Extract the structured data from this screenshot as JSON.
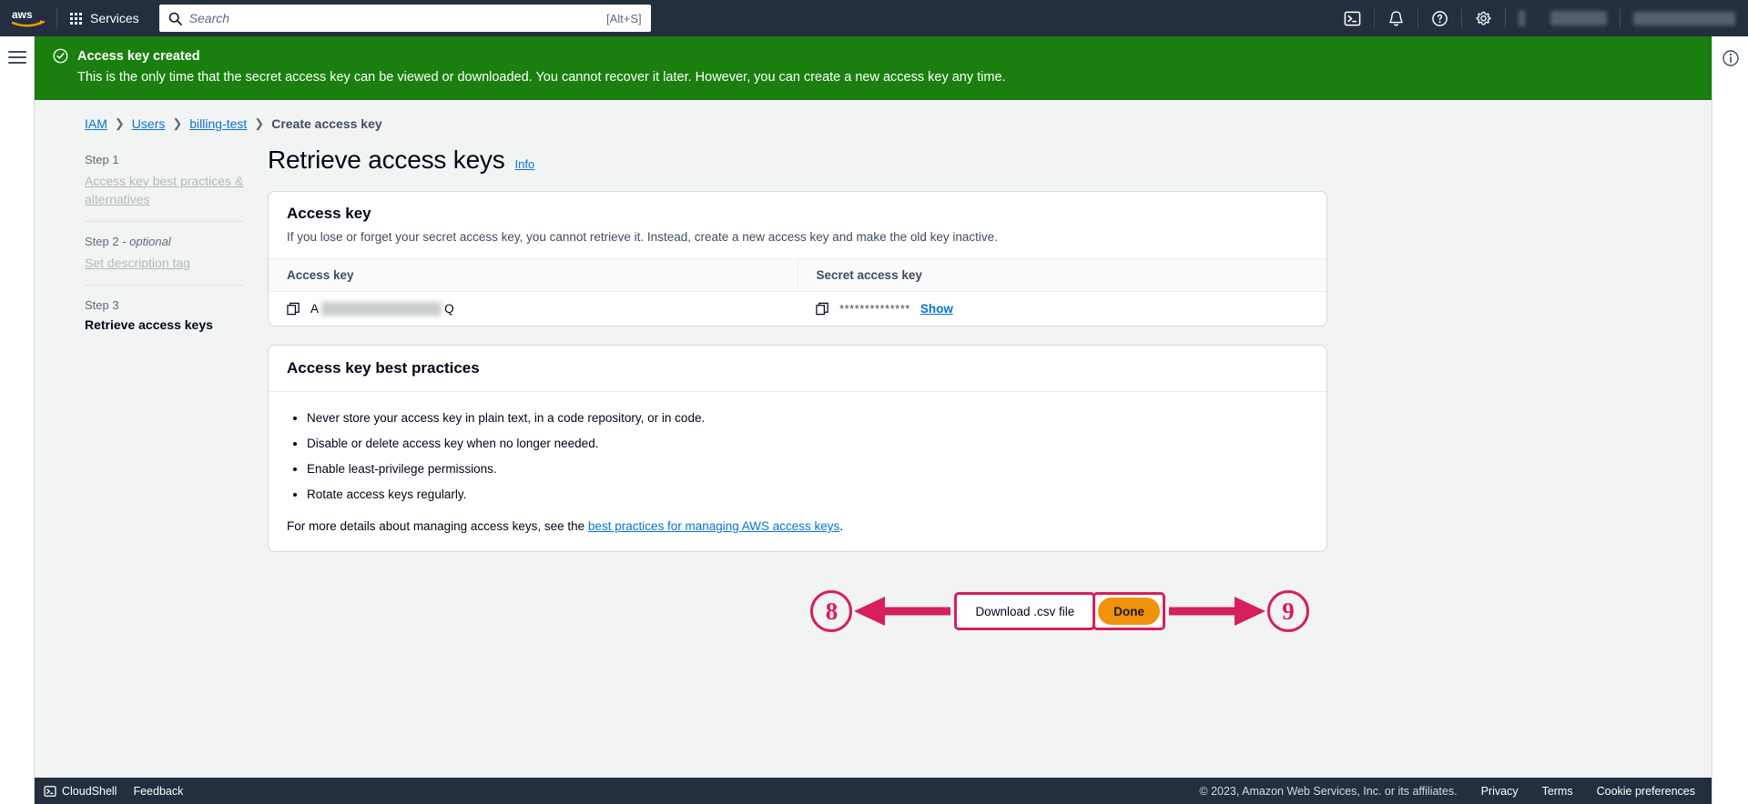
{
  "topnav": {
    "logo": "aws-logo",
    "services_label": "Services",
    "search_placeholder": "Search",
    "search_value": "",
    "search_shortcut": "[Alt+S]",
    "icons": [
      "cloudshell-icon",
      "notifications-bell-icon",
      "help-question-icon",
      "settings-gear-icon"
    ],
    "region_selector": "",
    "account_menu": ""
  },
  "flash": {
    "icon": "success-check-circle-icon",
    "title": "Access key created",
    "message": "This is the only time that the secret access key can be viewed or downloaded. You cannot recover it later. However, you can create a new access key any time.",
    "color": "#1a7f0e"
  },
  "rails": {
    "menu_icon": "hamburger-menu-icon",
    "info_panel_icon": "info-circle-icon"
  },
  "breadcrumb": {
    "items": [
      {
        "label": "IAM",
        "link": true
      },
      {
        "label": "Users",
        "link": true
      },
      {
        "label": "billing-test",
        "link": true
      },
      {
        "label": "Create access key",
        "link": false
      }
    ],
    "separator": "›"
  },
  "steps": [
    {
      "number": "Step 1",
      "optional": "",
      "label": "Access key best practices & alternatives",
      "state": "done"
    },
    {
      "number": "Step 2",
      "optional": " - optional",
      "label": "Set description tag",
      "state": "done"
    },
    {
      "number": "Step 3",
      "optional": "",
      "label": "Retrieve access keys",
      "state": "current"
    }
  ],
  "page": {
    "title": "Retrieve access keys",
    "info_label": "Info"
  },
  "access_key_card": {
    "heading": "Access key",
    "description": "If you lose or forget your secret access key, you cannot retrieve it. Instead, create a new access key and make the old key inactive.",
    "columns": [
      "Access key",
      "Secret access key"
    ],
    "access_key_prefix": "A",
    "access_key_suffix": "Q",
    "secret_mask": "**************",
    "show_label": "Show",
    "copy_icon": "copy-icon"
  },
  "best_practices": {
    "heading": "Access key best practices",
    "bullets": [
      "Never store your access key in plain text, in a code repository, or in code.",
      "Disable or delete access key when no longer needed.",
      "Enable least-privilege permissions.",
      "Rotate access keys regularly."
    ],
    "more_text_before": "For more details about managing access keys, see the ",
    "more_link": "best practices for managing AWS access keys",
    "more_text_after": "."
  },
  "actions": {
    "download_label": "Download .csv file",
    "done_label": "Done",
    "annotation_left": "8",
    "annotation_right": "9",
    "highlight_color": "#d61f5c",
    "primary_color": "#f0930a"
  },
  "footer": {
    "cloudshell": "CloudShell",
    "feedback": "Feedback",
    "copyright": "© 2023, Amazon Web Services, Inc. or its affiliates.",
    "links": [
      "Privacy",
      "Terms",
      "Cookie preferences"
    ]
  }
}
